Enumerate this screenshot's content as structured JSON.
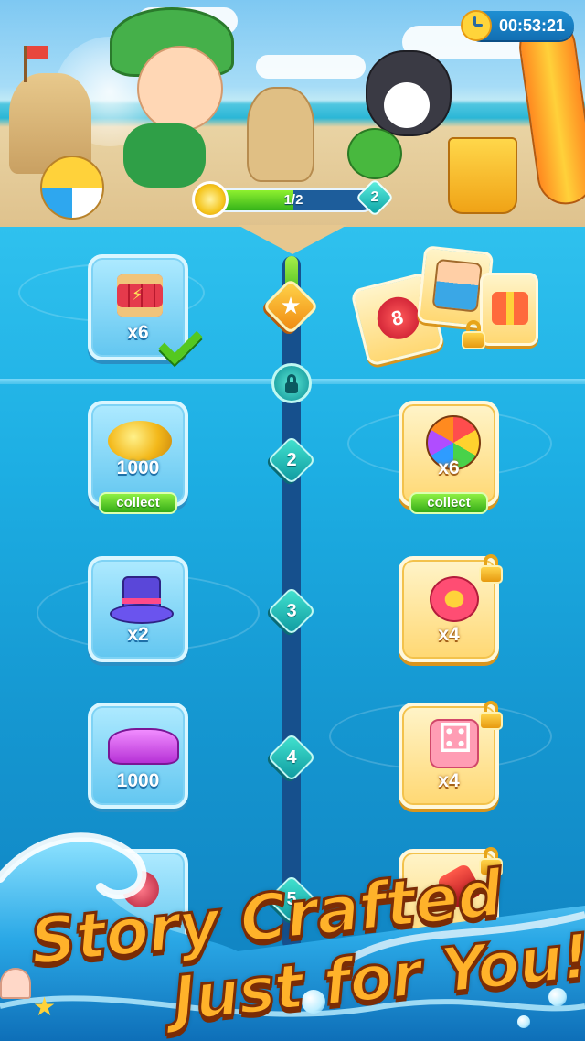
{
  "timer": {
    "value": "00:53:21",
    "icon": "stopwatch-icon"
  },
  "progress": {
    "label": "1/2",
    "fraction": 0.5,
    "next_level": "2"
  },
  "track": {
    "nodes": [
      "2",
      "3",
      "4",
      "5"
    ]
  },
  "rewards": {
    "row1": {
      "left_qty": "x6",
      "left_icon": "dynamite-icon",
      "left_claimed": true,
      "right_heart": "8",
      "right_icons": [
        "heart-card-icon",
        "character-card-icon",
        "gift-card-icon"
      ]
    },
    "row2": {
      "left_qty": "1000",
      "left_icon": "coins-icon",
      "left_action": "collect",
      "right_qty": "x6",
      "right_icon": "rainbow-ball-icon",
      "right_action": "collect"
    },
    "row3": {
      "left_qty": "x2",
      "left_icon": "magic-hat-icon",
      "right_qty": "x4",
      "right_icon": "flower-booster-icon"
    },
    "row4": {
      "left_qty": "1000",
      "left_icon": "gems-icon",
      "right_qty": "x4",
      "right_icon": "dice-icon"
    },
    "row5": {
      "left_icon": "horn-icon",
      "right_icon": "hammer-icon"
    }
  },
  "slogan": {
    "line1": "Story Crafted",
    "line2": "Just for You!"
  },
  "colors": {
    "accent_gold": "#ffb22a",
    "collect_green": "#34ab17",
    "track_blue": "#16508d"
  }
}
